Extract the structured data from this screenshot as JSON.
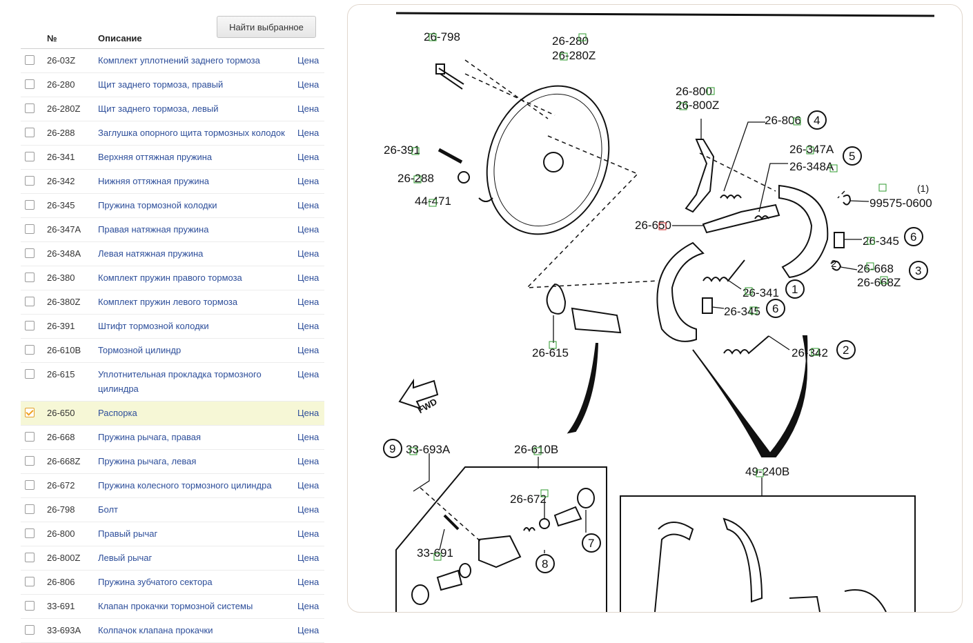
{
  "toolbar": {
    "find_selected_label": "Найти выбранное"
  },
  "table": {
    "col_number": "№",
    "col_description": "Описание",
    "rows": [
      {
        "num": "26-03Z",
        "desc": "Комплект уплотнений заднего тормоза",
        "price": "Цена",
        "checked": false
      },
      {
        "num": "26-280",
        "desc": "Щит заднего тормоза, правый",
        "price": "Цена",
        "checked": false
      },
      {
        "num": "26-280Z",
        "desc": "Щит заднего тормоза, левый",
        "price": "Цена",
        "checked": false
      },
      {
        "num": "26-288",
        "desc": "Заглушка опорного щита тормозных колодок",
        "price": "Цена",
        "checked": false
      },
      {
        "num": "26-341",
        "desc": "Верхняя оттяжная пружина",
        "price": "Цена",
        "checked": false
      },
      {
        "num": "26-342",
        "desc": "Нижняя оттяжная пружина",
        "price": "Цена",
        "checked": false
      },
      {
        "num": "26-345",
        "desc": "Пружина тормозной колодки",
        "price": "Цена",
        "checked": false
      },
      {
        "num": "26-347A",
        "desc": "Правая натяжная пружина",
        "price": "Цена",
        "checked": false
      },
      {
        "num": "26-348A",
        "desc": "Левая натяжная пружина",
        "price": "Цена",
        "checked": false
      },
      {
        "num": "26-380",
        "desc": "Комплект пружин правого тормоза",
        "price": "Цена",
        "checked": false
      },
      {
        "num": "26-380Z",
        "desc": "Комплект пружин левого тормоза",
        "price": "Цена",
        "checked": false
      },
      {
        "num": "26-391",
        "desc": "Штифт тормозной колодки",
        "price": "Цена",
        "checked": false
      },
      {
        "num": "26-610B",
        "desc": "Тормозной цилиндр",
        "price": "Цена",
        "checked": false
      },
      {
        "num": "26-615",
        "desc": "Уплотнительная прокладка тормозного цилиндра",
        "price": "Цена",
        "checked": false
      },
      {
        "num": "26-650",
        "desc": "Распорка",
        "price": "Цена",
        "checked": true
      },
      {
        "num": "26-668",
        "desc": "Пружина рычага, правая",
        "price": "Цена",
        "checked": false
      },
      {
        "num": "26-668Z",
        "desc": "Пружина рычага, левая",
        "price": "Цена",
        "checked": false
      },
      {
        "num": "26-672",
        "desc": "Пружина колесного тормозного цилиндра",
        "price": "Цена",
        "checked": false
      },
      {
        "num": "26-798",
        "desc": "Болт",
        "price": "Цена",
        "checked": false
      },
      {
        "num": "26-800",
        "desc": "Правый рычаг",
        "price": "Цена",
        "checked": false
      },
      {
        "num": "26-800Z",
        "desc": "Левый рычаг",
        "price": "Цена",
        "checked": false
      },
      {
        "num": "26-806",
        "desc": "Пружина зубчатого сектора",
        "price": "Цена",
        "checked": false
      },
      {
        "num": "33-691",
        "desc": "Клапан прокачки тормозной системы",
        "price": "Цена",
        "checked": false
      },
      {
        "num": "33-693A",
        "desc": "Колпачок клапана прокачки",
        "price": "Цена",
        "checked": false
      }
    ]
  },
  "diagram": {
    "labels": {
      "l26798": "26-798",
      "l26280": "26-280",
      "l26280z": "26-280Z",
      "l26800": "26-800",
      "l26800z": "26-800Z",
      "l26806": "26-806",
      "l26347a": "26-347A",
      "l26348a": "26-348A",
      "l26391": "26-391",
      "l26288": "26-288",
      "l44471": "44-471",
      "l99575": "99575-0600",
      "l26650": "26-650",
      "l26345a": "26-345",
      "l26668": "26-668",
      "l26668z": "26-668Z",
      "l26341": "26-341",
      "l26345b": "26-345",
      "l26615": "26-615",
      "l26342": "26-342",
      "l33693a": "33-693A",
      "l26610b": "26-610B",
      "l49240b": "49-240B",
      "l26672": "26-672",
      "l33691": "33-691",
      "fwd": "FWD",
      "qty": "(1)"
    },
    "callouts": {
      "c4": "4",
      "c5": "5",
      "c6a": "6",
      "c3": "3",
      "c1": "1",
      "c6b": "6",
      "c2": "2",
      "c9": "9",
      "c7": "7",
      "c8": "8",
      "c3b": "2"
    },
    "colors": {
      "marker_normal": "#2c9a2c",
      "marker_selected": "#d02828"
    }
  }
}
